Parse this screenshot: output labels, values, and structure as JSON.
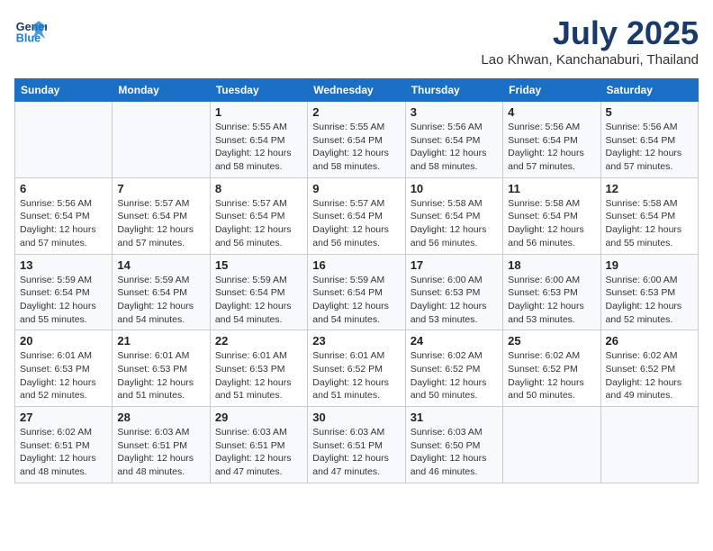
{
  "header": {
    "logo_line1": "General",
    "logo_line2": "Blue",
    "month": "July 2025",
    "location": "Lao Khwan, Kanchanaburi, Thailand"
  },
  "days_of_week": [
    "Sunday",
    "Monday",
    "Tuesday",
    "Wednesday",
    "Thursday",
    "Friday",
    "Saturday"
  ],
  "weeks": [
    [
      {
        "num": "",
        "info": ""
      },
      {
        "num": "",
        "info": ""
      },
      {
        "num": "1",
        "info": "Sunrise: 5:55 AM\nSunset: 6:54 PM\nDaylight: 12 hours and 58 minutes."
      },
      {
        "num": "2",
        "info": "Sunrise: 5:55 AM\nSunset: 6:54 PM\nDaylight: 12 hours and 58 minutes."
      },
      {
        "num": "3",
        "info": "Sunrise: 5:56 AM\nSunset: 6:54 PM\nDaylight: 12 hours and 58 minutes."
      },
      {
        "num": "4",
        "info": "Sunrise: 5:56 AM\nSunset: 6:54 PM\nDaylight: 12 hours and 57 minutes."
      },
      {
        "num": "5",
        "info": "Sunrise: 5:56 AM\nSunset: 6:54 PM\nDaylight: 12 hours and 57 minutes."
      }
    ],
    [
      {
        "num": "6",
        "info": "Sunrise: 5:56 AM\nSunset: 6:54 PM\nDaylight: 12 hours and 57 minutes."
      },
      {
        "num": "7",
        "info": "Sunrise: 5:57 AM\nSunset: 6:54 PM\nDaylight: 12 hours and 57 minutes."
      },
      {
        "num": "8",
        "info": "Sunrise: 5:57 AM\nSunset: 6:54 PM\nDaylight: 12 hours and 56 minutes."
      },
      {
        "num": "9",
        "info": "Sunrise: 5:57 AM\nSunset: 6:54 PM\nDaylight: 12 hours and 56 minutes."
      },
      {
        "num": "10",
        "info": "Sunrise: 5:58 AM\nSunset: 6:54 PM\nDaylight: 12 hours and 56 minutes."
      },
      {
        "num": "11",
        "info": "Sunrise: 5:58 AM\nSunset: 6:54 PM\nDaylight: 12 hours and 56 minutes."
      },
      {
        "num": "12",
        "info": "Sunrise: 5:58 AM\nSunset: 6:54 PM\nDaylight: 12 hours and 55 minutes."
      }
    ],
    [
      {
        "num": "13",
        "info": "Sunrise: 5:59 AM\nSunset: 6:54 PM\nDaylight: 12 hours and 55 minutes."
      },
      {
        "num": "14",
        "info": "Sunrise: 5:59 AM\nSunset: 6:54 PM\nDaylight: 12 hours and 54 minutes."
      },
      {
        "num": "15",
        "info": "Sunrise: 5:59 AM\nSunset: 6:54 PM\nDaylight: 12 hours and 54 minutes."
      },
      {
        "num": "16",
        "info": "Sunrise: 5:59 AM\nSunset: 6:54 PM\nDaylight: 12 hours and 54 minutes."
      },
      {
        "num": "17",
        "info": "Sunrise: 6:00 AM\nSunset: 6:53 PM\nDaylight: 12 hours and 53 minutes."
      },
      {
        "num": "18",
        "info": "Sunrise: 6:00 AM\nSunset: 6:53 PM\nDaylight: 12 hours and 53 minutes."
      },
      {
        "num": "19",
        "info": "Sunrise: 6:00 AM\nSunset: 6:53 PM\nDaylight: 12 hours and 52 minutes."
      }
    ],
    [
      {
        "num": "20",
        "info": "Sunrise: 6:01 AM\nSunset: 6:53 PM\nDaylight: 12 hours and 52 minutes."
      },
      {
        "num": "21",
        "info": "Sunrise: 6:01 AM\nSunset: 6:53 PM\nDaylight: 12 hours and 51 minutes."
      },
      {
        "num": "22",
        "info": "Sunrise: 6:01 AM\nSunset: 6:53 PM\nDaylight: 12 hours and 51 minutes."
      },
      {
        "num": "23",
        "info": "Sunrise: 6:01 AM\nSunset: 6:52 PM\nDaylight: 12 hours and 51 minutes."
      },
      {
        "num": "24",
        "info": "Sunrise: 6:02 AM\nSunset: 6:52 PM\nDaylight: 12 hours and 50 minutes."
      },
      {
        "num": "25",
        "info": "Sunrise: 6:02 AM\nSunset: 6:52 PM\nDaylight: 12 hours and 50 minutes."
      },
      {
        "num": "26",
        "info": "Sunrise: 6:02 AM\nSunset: 6:52 PM\nDaylight: 12 hours and 49 minutes."
      }
    ],
    [
      {
        "num": "27",
        "info": "Sunrise: 6:02 AM\nSunset: 6:51 PM\nDaylight: 12 hours and 48 minutes."
      },
      {
        "num": "28",
        "info": "Sunrise: 6:03 AM\nSunset: 6:51 PM\nDaylight: 12 hours and 48 minutes."
      },
      {
        "num": "29",
        "info": "Sunrise: 6:03 AM\nSunset: 6:51 PM\nDaylight: 12 hours and 47 minutes."
      },
      {
        "num": "30",
        "info": "Sunrise: 6:03 AM\nSunset: 6:51 PM\nDaylight: 12 hours and 47 minutes."
      },
      {
        "num": "31",
        "info": "Sunrise: 6:03 AM\nSunset: 6:50 PM\nDaylight: 12 hours and 46 minutes."
      },
      {
        "num": "",
        "info": ""
      },
      {
        "num": "",
        "info": ""
      }
    ]
  ]
}
